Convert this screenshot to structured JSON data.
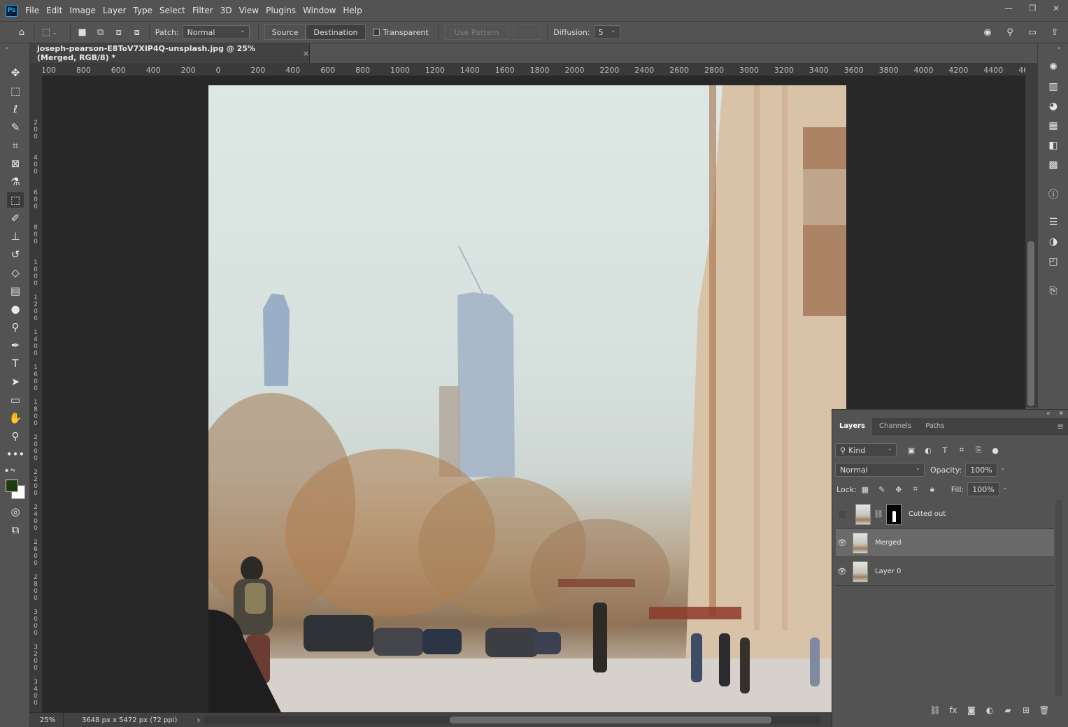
{
  "app": {
    "logo_text": "Ps"
  },
  "menu": [
    "File",
    "Edit",
    "Image",
    "Layer",
    "Type",
    "Select",
    "Filter",
    "3D",
    "View",
    "Plugins",
    "Window",
    "Help"
  ],
  "window_controls": {
    "minimize": "—",
    "restore": "❐",
    "close": "✕"
  },
  "options_bar": {
    "patch_label": "Patch:",
    "patch_mode": "Normal",
    "source_label": "Source",
    "destination_label": "Destination",
    "transparent_label": "Transparent",
    "use_pattern_label": "Use Pattern",
    "diffusion_label": "Diffusion:",
    "diffusion_value": "5"
  },
  "document": {
    "tab_title": "joseph-pearson-E8ToV7XIP4Q-unsplash.jpg @ 25% (Merged, RGB/8) *",
    "close_glyph": "×"
  },
  "ruler_h": [
    "100",
    "800",
    "600",
    "400",
    "200",
    "0",
    "200",
    "400",
    "600",
    "800",
    "1000",
    "1200",
    "1400",
    "1600",
    "1800",
    "2000",
    "2200",
    "2400",
    "2600",
    "2800",
    "3000",
    "3200",
    "3400",
    "3600",
    "3800",
    "4000",
    "4200",
    "4400",
    "46"
  ],
  "ruler_v": [
    "2 0 0",
    "4 0 0",
    "6 0 0",
    "8 0 0",
    "1 0 0 0",
    "1 2 0 0",
    "1 4 0 0",
    "1 6 0 0",
    "1 8 0 0",
    "2 0 0 0",
    "2 2 0 0",
    "2 4 0 0",
    "2 6 0 0",
    "2 8 0 0",
    "3 0 0 0",
    "3 2 0 0",
    "3 4 0 0"
  ],
  "status": {
    "zoom": "25%",
    "doc_size": "3648 px x 5472 px (72 ppi)",
    "arrow": "›"
  },
  "colors": {
    "foreground": "#1f3a12",
    "background": "#ffffff",
    "accent": "#31a8ff"
  },
  "layers_panel": {
    "tabs": [
      "Layers",
      "Channels",
      "Paths"
    ],
    "filter_kind": "Kind",
    "blend_mode": "Normal",
    "opacity_label": "Opacity:",
    "opacity_value": "100%",
    "lock_label": "Lock:",
    "fill_label": "Fill:",
    "fill_value": "100%",
    "layers": [
      {
        "name": "Cutted out",
        "visible": false,
        "selected": false,
        "has_mask": true
      },
      {
        "name": "Merged",
        "visible": true,
        "selected": true,
        "has_mask": false
      },
      {
        "name": "Layer 0",
        "visible": true,
        "selected": false,
        "has_mask": false
      }
    ]
  }
}
